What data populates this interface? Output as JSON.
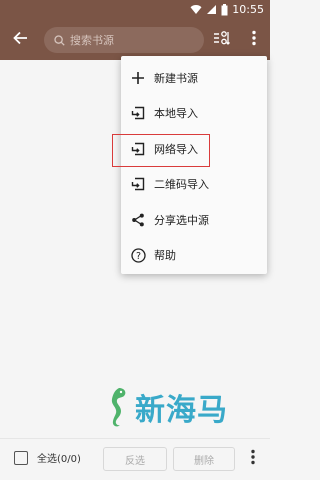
{
  "status_bar": {
    "time": "10:55"
  },
  "toolbar": {
    "search_placeholder": "搜索书源",
    "back_icon": "arrow-back-icon",
    "sort_icon": "sort-icon",
    "more_icon": "more-vert-icon",
    "background_color": "#7b5546"
  },
  "menu": {
    "items": [
      {
        "label": "新建书源",
        "icon": "plus-icon"
      },
      {
        "label": "本地导入",
        "icon": "import-icon"
      },
      {
        "label": "网络导入",
        "icon": "import-icon",
        "highlighted": true
      },
      {
        "label": "二维码导入",
        "icon": "import-icon"
      },
      {
        "label": "分享选中源",
        "icon": "share-icon"
      },
      {
        "label": "帮助",
        "icon": "help-icon"
      }
    ],
    "highlight_color": "#d93b3b"
  },
  "watermark": {
    "text": "新海马",
    "color": "#39a9c9"
  },
  "bottom_bar": {
    "select_all_label": "全选(0/0)",
    "invert_label": "反选",
    "delete_label": "删除"
  }
}
